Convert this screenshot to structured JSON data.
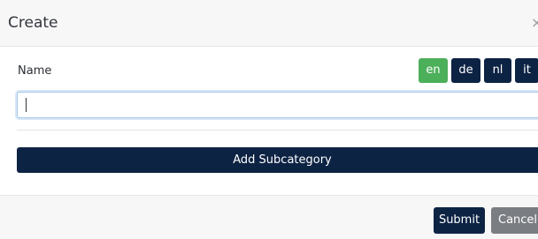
{
  "modal": {
    "title": "Create",
    "close_symbol": "×"
  },
  "form": {
    "name_label": "Name",
    "name_value": "",
    "languages": [
      {
        "code": "en",
        "active": true
      },
      {
        "code": "de",
        "active": false
      },
      {
        "code": "nl",
        "active": false
      },
      {
        "code": "it",
        "active": false
      }
    ],
    "add_subcategory_label": "Add Subcategory"
  },
  "footer": {
    "submit_label": "Submit",
    "cancel_label": "Cancel"
  },
  "colors": {
    "primary": "#0d2344",
    "active_language": "#4caf5a",
    "cancel": "#7a7d82"
  }
}
